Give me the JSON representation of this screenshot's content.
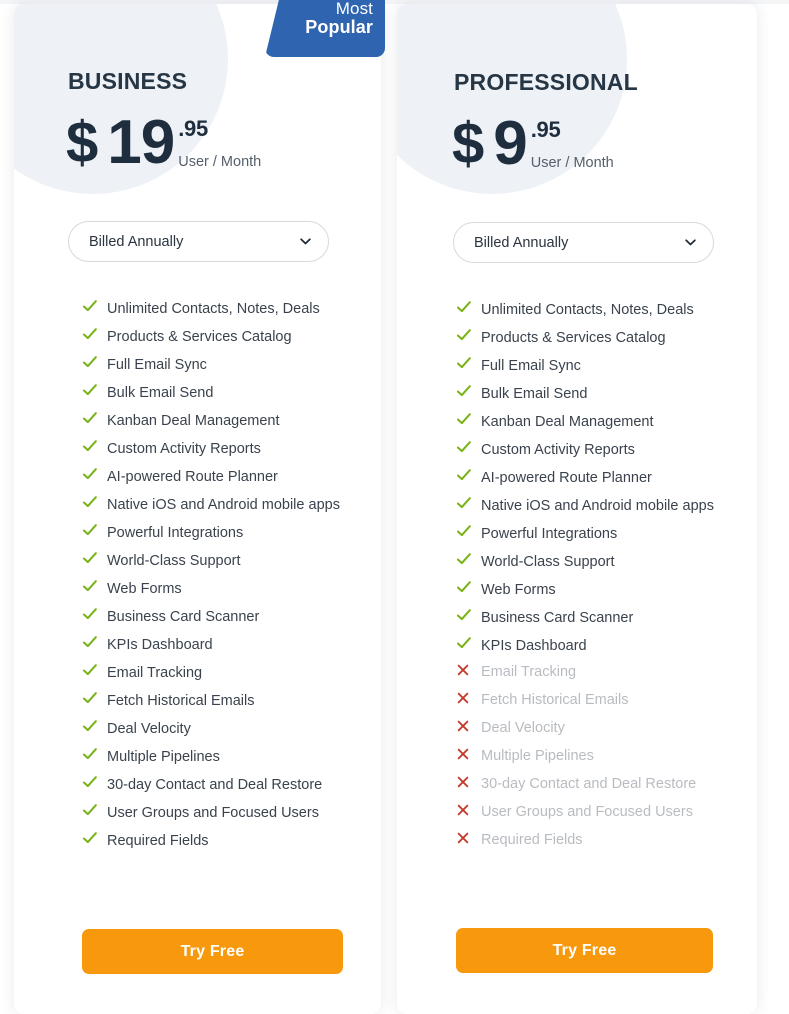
{
  "page": {
    "background": "#ffffff",
    "accent_orange": "#f8980c",
    "accent_blue": "#2f64b0",
    "check_green": "#7ab317",
    "cross_red": "#c0392b",
    "price_color": "#1e2e3e"
  },
  "badge": {
    "line1": "Most",
    "line2": "Popular"
  },
  "plans": [
    {
      "id": "business",
      "name": "BUSINESS",
      "currency": "$",
      "price_whole": "19",
      "price_cents": ".95",
      "period": "User / Month",
      "billing_selected": "Billed Annually",
      "billing_options": [
        "Billed Annually"
      ],
      "cta_label": "Try Free",
      "is_most_popular": true,
      "features": [
        {
          "label": "Unlimited Contacts, Notes, Deals",
          "included": true
        },
        {
          "label": "Products & Services Catalog",
          "included": true
        },
        {
          "label": "Full Email Sync",
          "included": true
        },
        {
          "label": "Bulk Email Send",
          "included": true
        },
        {
          "label": "Kanban Deal Management",
          "included": true
        },
        {
          "label": "Custom Activity Reports",
          "included": true
        },
        {
          "label": "AI-powered Route Planner",
          "included": true
        },
        {
          "label": "Native iOS and Android mobile apps",
          "included": true
        },
        {
          "label": "Powerful Integrations",
          "included": true
        },
        {
          "label": "World-Class Support",
          "included": true
        },
        {
          "label": "Web Forms",
          "included": true
        },
        {
          "label": "Business Card Scanner",
          "included": true
        },
        {
          "label": "KPIs Dashboard",
          "included": true
        },
        {
          "label": "Email Tracking",
          "included": true
        },
        {
          "label": "Fetch Historical Emails",
          "included": true
        },
        {
          "label": "Deal Velocity",
          "included": true
        },
        {
          "label": "Multiple Pipelines",
          "included": true
        },
        {
          "label": "30-day Contact and Deal Restore",
          "included": true
        },
        {
          "label": "User Groups and Focused Users",
          "included": true
        },
        {
          "label": "Required Fields",
          "included": true
        }
      ]
    },
    {
      "id": "professional",
      "name": "PROFESSIONAL",
      "currency": "$",
      "price_whole": "9",
      "price_cents": ".95",
      "period": "User / Month",
      "billing_selected": "Billed Annually",
      "billing_options": [
        "Billed Annually"
      ],
      "cta_label": "Try Free",
      "is_most_popular": false,
      "features": [
        {
          "label": "Unlimited Contacts, Notes, Deals",
          "included": true
        },
        {
          "label": "Products & Services Catalog",
          "included": true
        },
        {
          "label": "Full Email Sync",
          "included": true
        },
        {
          "label": "Bulk Email Send",
          "included": true
        },
        {
          "label": "Kanban Deal Management",
          "included": true
        },
        {
          "label": "Custom Activity Reports",
          "included": true
        },
        {
          "label": "AI-powered Route Planner",
          "included": true
        },
        {
          "label": "Native iOS and Android mobile apps",
          "included": true
        },
        {
          "label": "Powerful Integrations",
          "included": true
        },
        {
          "label": "World-Class Support",
          "included": true
        },
        {
          "label": "Web Forms",
          "included": true
        },
        {
          "label": "Business Card Scanner",
          "included": true
        },
        {
          "label": "KPIs Dashboard",
          "included": true
        },
        {
          "label": "Email Tracking",
          "included": false
        },
        {
          "label": "Fetch Historical Emails",
          "included": false
        },
        {
          "label": "Deal Velocity",
          "included": false
        },
        {
          "label": "Multiple Pipelines",
          "included": false
        },
        {
          "label": "30-day Contact and Deal Restore",
          "included": false
        },
        {
          "label": "User Groups and Focused Users",
          "included": false
        },
        {
          "label": "Required Fields",
          "included": false
        }
      ]
    }
  ],
  "icons": {
    "check": "check-icon",
    "cross": "cross-icon",
    "chevron": "chevron-down-icon"
  }
}
